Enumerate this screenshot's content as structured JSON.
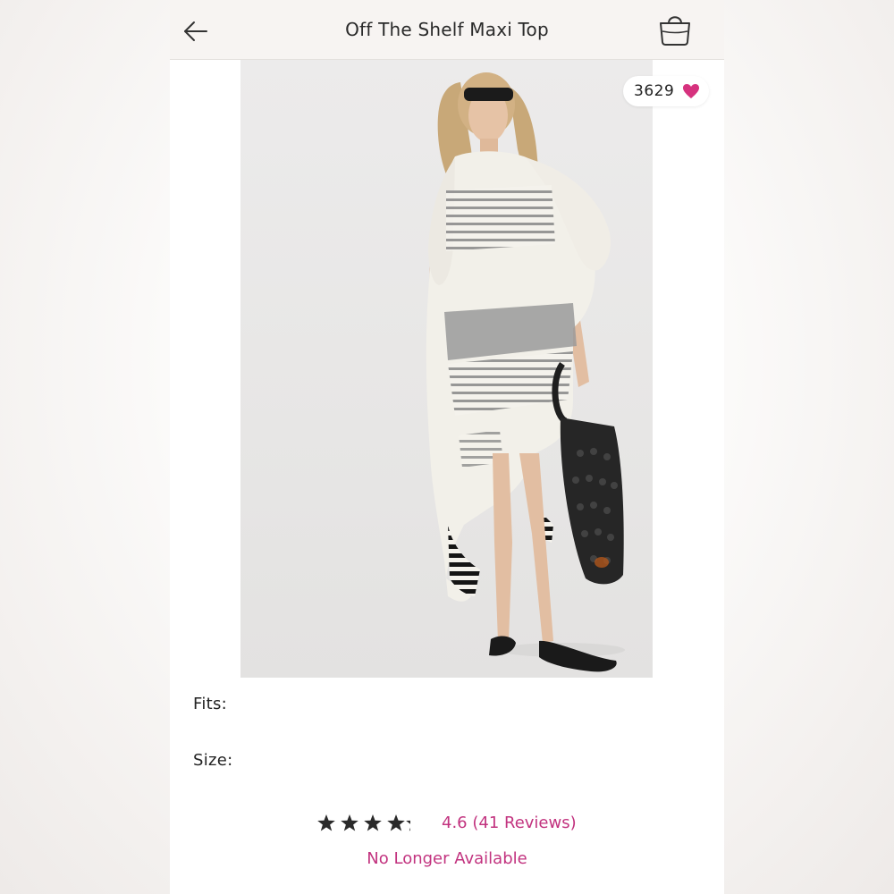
{
  "header": {
    "title": "Off The Shelf Maxi Top",
    "back_icon": "arrow-left-icon",
    "bag_icon": "shopping-bag-icon"
  },
  "product": {
    "image_alt": "Model wearing striped oversized maxi top",
    "likes": "3629",
    "like_icon": "heart-icon",
    "like_color": "#d6327e"
  },
  "details": {
    "fits_label": "Fits:",
    "size_label": "Size:"
  },
  "rating": {
    "value": 4.6,
    "max": 5,
    "text": "4.6 (41 Reviews)"
  },
  "status": {
    "text": "No Longer Available"
  },
  "colors": {
    "accent": "#c2337f",
    "header_bg": "#f7f4f2"
  }
}
